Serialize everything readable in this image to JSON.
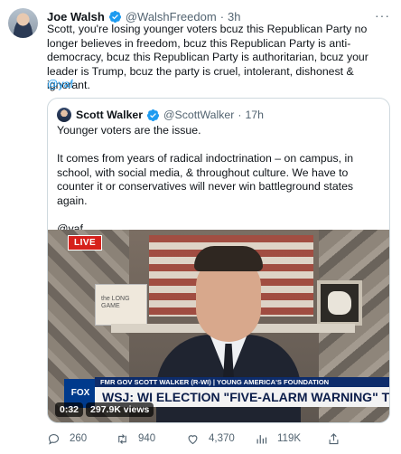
{
  "tweet": {
    "author_name": "Joe Walsh",
    "author_handle": "@WalshFreedom",
    "time": "3h",
    "text": "Scott, you're losing younger voters bcuz this Republican Party no longer believes in freedom, bcuz this Republican Party is anti-democracy, bcuz this Republican Party is authoritarian, bcuz your leader is Trump, bcuz the party is cruel, intolerant, dishonest & ignorant.",
    "mention": "@yaf"
  },
  "quoted": {
    "author_name": "Scott Walker",
    "author_handle": "@ScottWalker",
    "time": "17h",
    "line1": "Younger voters are the issue.",
    "line2": "It comes from years of radical indoctrination – on campus, in school, with social media, & throughout culture. We have to counter it or conservatives will never win battleground states again.",
    "line3": "@yaf"
  },
  "video": {
    "live_label": "LIVE",
    "book_text": "the LONG GAME",
    "chyron_top": "FMR GOV SCOTT WALKER (R-WI) | YOUNG AMERICA'S FOUNDATION",
    "chyron_main": "WSJ: WI ELECTION \"FIVE-ALARM WARNING\" TO GOP",
    "network": "FOX",
    "elapsed": "0:32",
    "views": "297.9K views"
  },
  "actions": {
    "replies": "260",
    "retweets": "940",
    "likes": "4,370",
    "views": "119K"
  },
  "colors": {
    "accent": "#1d9bf0",
    "muted": "#536471",
    "border": "#cfd9de"
  }
}
